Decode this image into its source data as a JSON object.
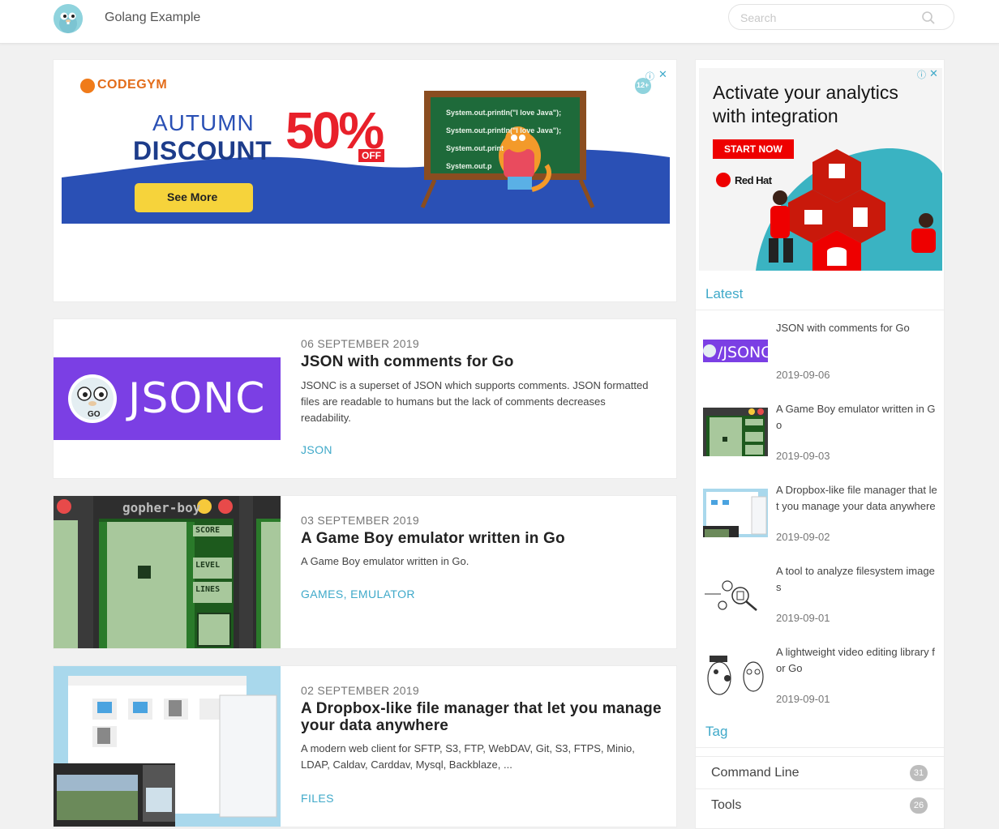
{
  "header": {
    "site_title": "Golang Example",
    "search_placeholder": "Search",
    "logo_icon": "gopher-logo-icon",
    "search_icon": "search-icon"
  },
  "ads": {
    "main": {
      "brand": "CODEGYM",
      "line1": "AUTUMN",
      "line2": "DISCOUNT",
      "percent": "50%",
      "off": "OFF",
      "button": "See More",
      "board_lines": [
        "System.out.println(\"I love Java\");",
        "System.out.println(\"I love Java\");",
        "System.out.print",
        "System.out.p"
      ],
      "age_badge": "12+"
    },
    "side": {
      "headline": "Activate your analytics with integration",
      "button": "START NOW",
      "brand": "Red Hat"
    }
  },
  "posts": [
    {
      "date": "06 SEPTEMBER 2019",
      "title": "JSON with comments for Go",
      "excerpt": "JSONC is a superset of JSON which supports comments. JSON formatted files are readable to humans but the lack of comments decreases readability.",
      "tags": [
        "JSON"
      ],
      "thumb_text": "JSONC",
      "thumb_sub": "GO"
    },
    {
      "date": "03 SEPTEMBER 2019",
      "title": "A Game Boy emulator written in Go",
      "excerpt": "A Game Boy emulator written in Go.",
      "tags": [
        "GAMES",
        "EMULATOR"
      ],
      "thumb_text": "gopher-boy",
      "thumb_labels": [
        "SCORE",
        "LEVEL",
        "LINES"
      ]
    },
    {
      "date": "02 SEPTEMBER 2019",
      "title": "A Dropbox-like file manager that let you manage your data anywhere",
      "excerpt": "A modern web client for SFTP, S3, FTP, WebDAV, Git, S3, FTPS, Minio, LDAP, Caldav, Carddav, Mysql, Backblaze, ...",
      "tags": [
        "FILES"
      ]
    }
  ],
  "sidebar": {
    "latest_heading": "Latest",
    "latest": [
      {
        "title": "JSON with comments for Go",
        "date": "2019-09-06"
      },
      {
        "title": "A Game Boy emulator written in Go",
        "date": "2019-09-03"
      },
      {
        "title": "A Dropbox-like file manager that let you manage your data anywhere",
        "date": "2019-09-02"
      },
      {
        "title": "A tool to analyze filesystem images",
        "date": "2019-09-01"
      },
      {
        "title": "A lightweight video editing library for Go",
        "date": "2019-09-01"
      }
    ],
    "tag_heading": "Tag",
    "tags": [
      {
        "name": "Command Line",
        "count": "31"
      },
      {
        "name": "Tools",
        "count": "26"
      }
    ]
  },
  "colors": {
    "accent": "#3fa9c9",
    "jsonc_purple": "#7b3fe4",
    "gameboy_green": "#8fb887",
    "redhat_red": "#ee0000"
  }
}
